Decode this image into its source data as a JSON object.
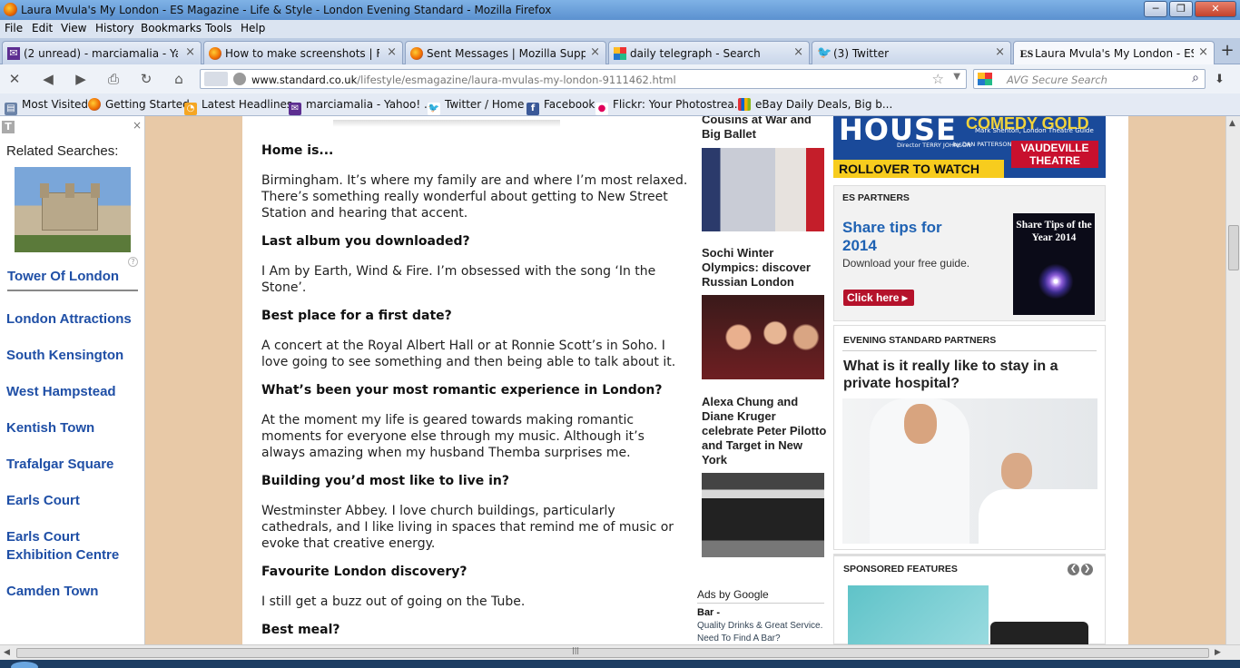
{
  "window": {
    "title": "Laura Mvula's My London - ES Magazine - Life & Style - London Evening Standard - Mozilla Firefox",
    "controls": {
      "minimize": "─",
      "maximize": "❐",
      "close": "✕"
    }
  },
  "menu": [
    "File",
    "Edit",
    "View",
    "History",
    "Bookmarks",
    "Tools",
    "Help"
  ],
  "tabs": [
    {
      "label": "(2 unread) - marciamalia - Yaho...",
      "icon": "yahoo-mail-icon"
    },
    {
      "label": "How to make screenshots | Firef...",
      "icon": "firefox-icon"
    },
    {
      "label": "Sent Messages | Mozilla Support",
      "icon": "firefox-icon"
    },
    {
      "label": "daily telegraph - Search",
      "icon": "search-results-icon"
    },
    {
      "label": "(3) Twitter",
      "icon": "twitter-icon"
    },
    {
      "label": "Laura Mvula's My London - ES ...",
      "icon": "es-icon"
    }
  ],
  "new_tab": "+",
  "nav": {
    "url_domain": "www.standard.co.uk",
    "url_path": "/lifestyle/esmagazine/laura-mvulas-my-london-9111462.html",
    "search_placeholder": "AVG Secure Search"
  },
  "bookmarks": [
    {
      "label": "Most Visited",
      "icon": "bookmark-folder-icon"
    },
    {
      "label": "Getting Started",
      "icon": "firefox-icon"
    },
    {
      "label": "Latest Headlines",
      "icon": "rss-icon"
    },
    {
      "label": "marciamalia - Yahoo! ...",
      "icon": "yahoo-mail-icon"
    },
    {
      "label": "Twitter / Home",
      "icon": "twitter-icon"
    },
    {
      "label": "Facebook",
      "icon": "facebook-icon"
    },
    {
      "label": "Flickr: Your Photostrea...",
      "icon": "flickr-icon"
    },
    {
      "label": "eBay Daily Deals, Big b...",
      "icon": "ebay-icon"
    }
  ],
  "left_panel": {
    "badge": "T",
    "close": "×",
    "title": "Related Searches:",
    "help": "?",
    "links": [
      "Tower Of London",
      "London Attractions",
      "South Kensington",
      "West Hampstead",
      "Kentish Town",
      "Trafalgar Square",
      "Earls Court",
      "Earls Court Exhibition Centre",
      "Camden Town"
    ]
  },
  "article": {
    "qa": [
      {
        "q": "Home is...",
        "a": "Birmingham. It’s where my family are and where I’m most relaxed. There’s something really wonderful about getting to New Street Station and hearing that accent."
      },
      {
        "q": "Last album you downloaded?",
        "a": "I Am by Earth, Wind & Fire. I’m obsessed with the song ‘In the Stone’."
      },
      {
        "q": "Best place for a first date?",
        "a": "A concert at the Royal Albert Hall or at Ronnie Scott’s in Soho. I love going to see something and then being able to talk about it."
      },
      {
        "q": "What’s been your most romantic experience in London?",
        "a": "At the moment my life is geared towards making romantic moments for everyone else through my music. Although it’s always amazing when my husband Themba surprises me."
      },
      {
        "q": "Building you’d most like to live in?",
        "a": "Westminster Abbey. I love church buildings, particularly cathedrals, and I like living in spaces that remind me of music or evoke that creative energy."
      },
      {
        "q": "Favourite London discovery?",
        "a": "I still get a buzz out of going on the Tube."
      },
      {
        "q": "Best meal?",
        "a": ""
      }
    ]
  },
  "middle": {
    "items": [
      {
        "headline": "Cousins at War and Big Ballet"
      },
      {
        "headline": "Sochi Winter Olympics: discover Russian London"
      },
      {
        "headline": "Alexa Chung and Diane Kruger celebrate Peter Pilotto and Target in New York"
      }
    ],
    "ads_by": "Ads by Google",
    "ad_title": "Bar -",
    "ad_desc": "Quality Drinks & Great Service. Need To Find A Bar?"
  },
  "right": {
    "banner": {
      "house": "HOUSE",
      "comedy_gold": "COMEDY GOLD",
      "tagline": "Mark Shenton, London Theatre Guide",
      "director": "Director TERRY JOHNSON",
      "by": "by DAN PATTERSON and COLIN SWASH",
      "theatre": "VAUDEVILLE THEATRE",
      "cta": "ROLLOVER TO WATCH"
    },
    "es_partners": {
      "header": "ES PARTNERS",
      "title": "Share tips for 2014",
      "desc": "Download your free guide.",
      "button": "Click here ▸",
      "image_text": "Share Tips of the Year 2014"
    },
    "es_partners2": {
      "header": "EVENING STANDARD PARTNERS",
      "title": "What is it really like to stay in a private hospital?"
    },
    "sponsored": {
      "header": "SPONSORED FEATURES",
      "prev": "❮",
      "next": "❯"
    }
  }
}
